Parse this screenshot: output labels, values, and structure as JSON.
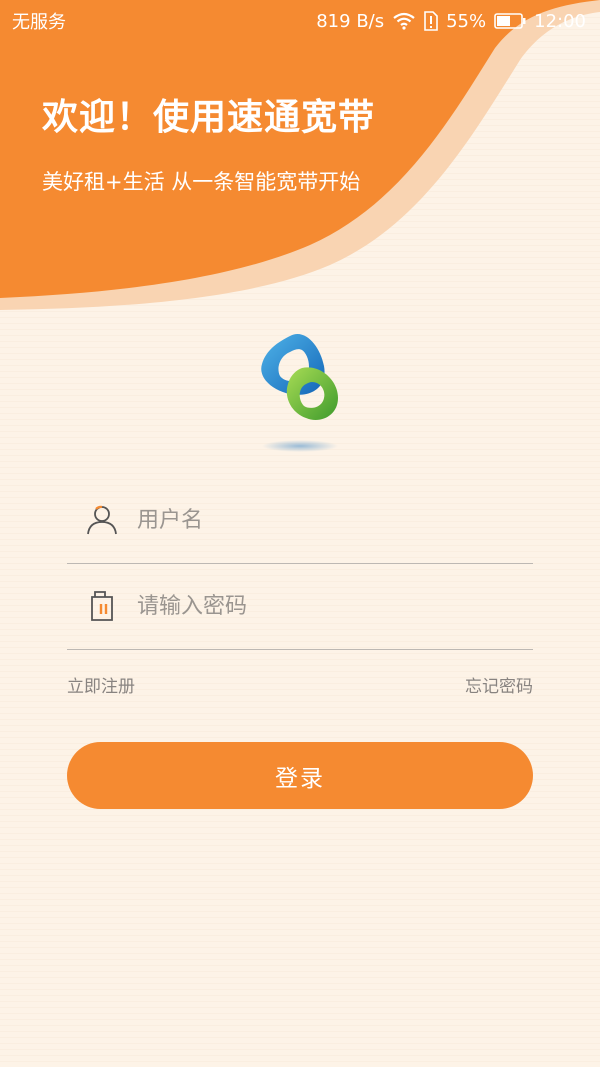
{
  "status_bar": {
    "carrier": "无服务",
    "speed": "819 B/s",
    "battery": "55%",
    "time": "12:00"
  },
  "header": {
    "title": "欢迎！使用速通宽带",
    "subtitle": "美好租+生活 从一条智能宽带开始"
  },
  "form": {
    "username_placeholder": "用户名",
    "password_placeholder": "请输入密码",
    "register_label": "立即注册",
    "forgot_label": "忘记密码",
    "login_label": "登录"
  },
  "colors": {
    "accent": "#f58a31",
    "background": "#fdf3e7"
  },
  "icons": {
    "user": "user-icon",
    "lock": "lock-icon",
    "logo": "app-logo-icon"
  }
}
